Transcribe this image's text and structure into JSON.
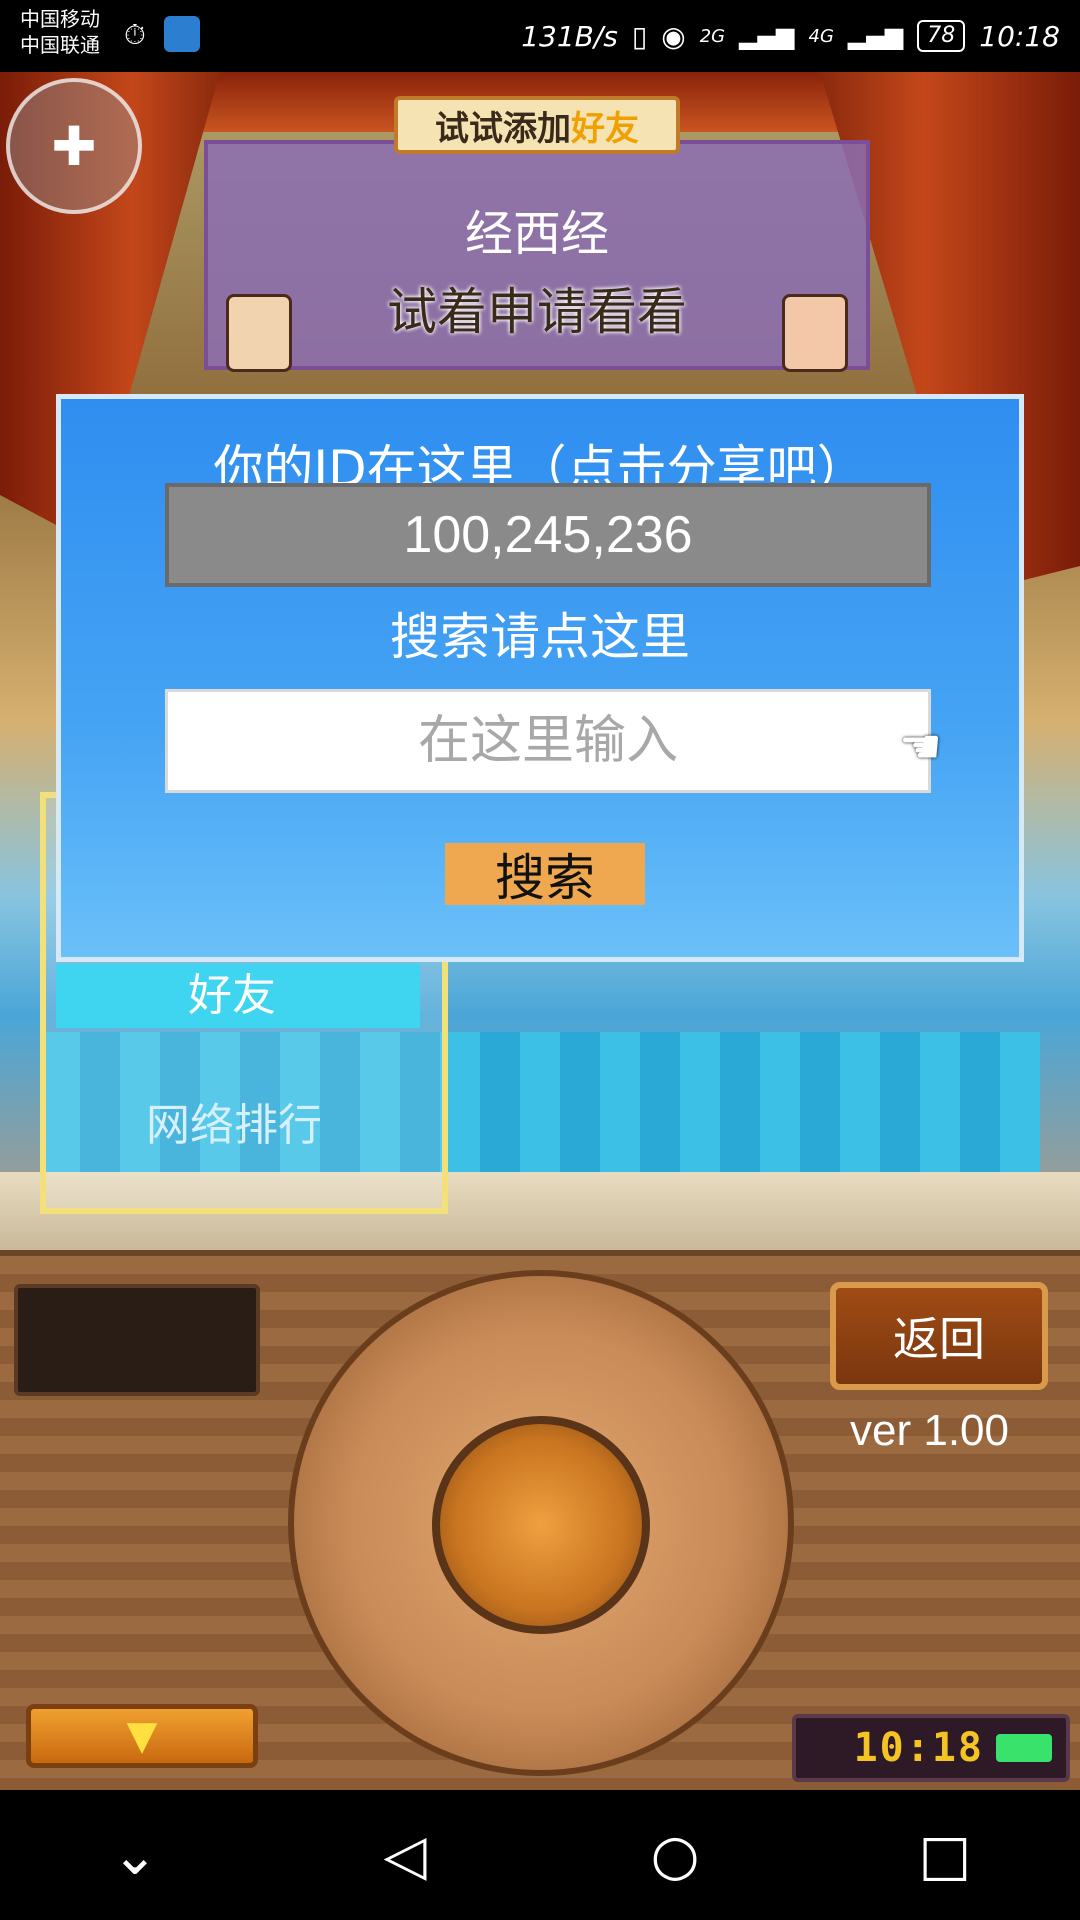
{
  "status_bar": {
    "carrier_1": "中国移动",
    "carrier_2": "中国联通",
    "net_speed": "131B/s",
    "net_1": "2G",
    "net_2": "4G",
    "battery": "78",
    "time": "10:18"
  },
  "notice": {
    "banner_prefix": "试试添加",
    "banner_highlight": "好友",
    "line1": "经西经",
    "line2": "试着申请看看"
  },
  "dialog": {
    "id_label": "你的ID在这里（点击分享吧）",
    "user_id": "100,245,236",
    "search_label": "搜索请点这里",
    "search_placeholder": "在这里输入",
    "search_button": "搜索"
  },
  "menu": {
    "friends": "好友",
    "ranking": "网络排行"
  },
  "console": {
    "back_button": "返回",
    "version": "ver 1.00",
    "clock": "10:18"
  },
  "nav": {
    "collapse_icon": "chevron-down",
    "back_icon": "triangle-left",
    "home_icon": "circle",
    "recents_icon": "square"
  }
}
